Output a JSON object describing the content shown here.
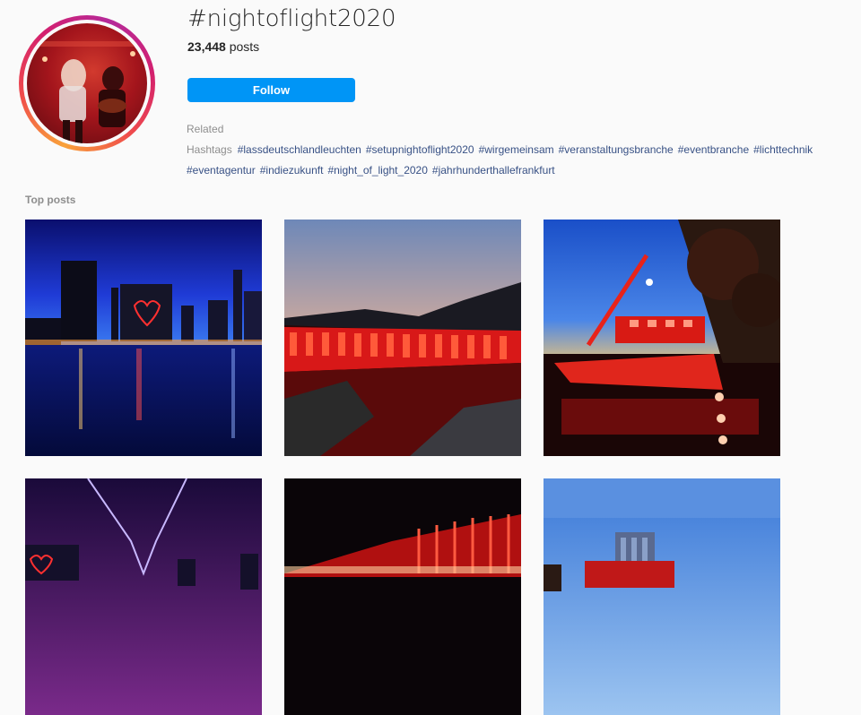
{
  "header": {
    "hashtag": "#nightoflight2020",
    "post_count": "23,448",
    "post_suffix": " posts",
    "follow_label": "Follow"
  },
  "related": {
    "label": "Related Hashtags",
    "tags": [
      "#lassdeutschlandleuchten",
      "#setupnightoflight2020",
      "#wirgemeinsam",
      "#veranstaltungsbranche",
      "#eventbranche",
      "#lichttechnik",
      "#eventagentur",
      "#indiezukunft",
      "#night_of_light_2020",
      "#jahrhunderthallefrankfurt"
    ]
  },
  "top_posts": {
    "label": "Top posts",
    "items": [
      {
        "icon": "frankfurt-skyline-heart-photo"
      },
      {
        "icon": "red-lit-dam-photo"
      },
      {
        "icon": "red-lit-ship-crane-photo"
      },
      {
        "icon": "bridge-heart-night-photo"
      },
      {
        "icon": "red-lit-facade-photo"
      },
      {
        "icon": "building-red-light-photo"
      }
    ]
  },
  "colors": {
    "accent": "#0095f6",
    "hashtag_link": "#385185",
    "muted": "#8e8e8e",
    "background": "#fafafa"
  }
}
